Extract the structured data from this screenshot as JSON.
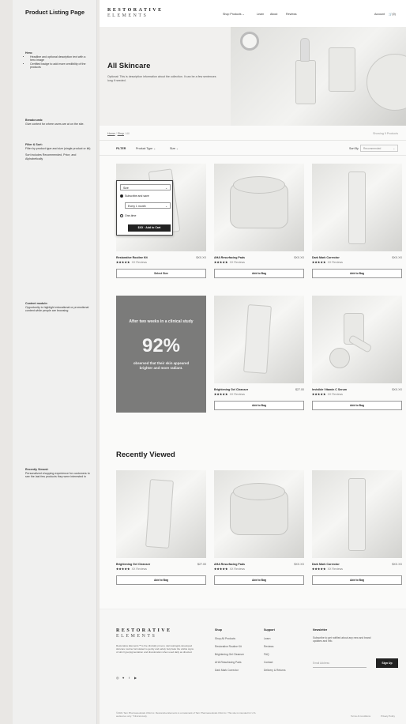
{
  "annotations": {
    "title": "Product Listing Page",
    "hero_head": "Hero:",
    "hero_items": [
      "Headline and optional description text with a hero image",
      "Certified badge to add more credibility of the products"
    ],
    "breadcrumb_head": "Breadcrumb:",
    "breadcrumb_text": "Give context for where users are at on the site.",
    "filter_head": "Filter & Sort:",
    "filter_text": "Filter by product type and size (single product or kit)",
    "sort_text": "Sort includes Recommended, Price, and Alphabetically",
    "content_head": "Content module:",
    "content_text": "Opportunity to highlight educational or promotional content while people are browsing",
    "recent_head": "Recently Viewed:",
    "recent_text": "Personalized shopping experience for customers to see the last few products they were interested in"
  },
  "header": {
    "logo_line1": "RESTORATIVE",
    "logo_line2": "ELEMENTS",
    "nav": [
      "Shop Products",
      "Learn",
      "About",
      "Reviews"
    ],
    "account": "Account",
    "cart": "(0)"
  },
  "hero": {
    "title": "All Skincare",
    "description": "Optional: This is description information about the collection. It can be a few sentences long if needed."
  },
  "breadcrumb": {
    "home": "Home",
    "shop": "Shop",
    "current": "All"
  },
  "showing": "Showing 9 Products",
  "filters": {
    "label": "FILTER",
    "product_type": "Product Type",
    "size": "Size",
    "sort_label": "Sort By",
    "sort_value": "Recommended"
  },
  "popover": {
    "size_select": "Size",
    "subscribe": "Subscribe and save",
    "frequency": "Every 1 month",
    "one_time": "One-time",
    "add_button": "$XX · Add to Cart"
  },
  "products_row1": [
    {
      "name": "Restorative Routine Kit",
      "price": "$XX.XX",
      "stars": "★★★★★",
      "reviews": "XX Reviews",
      "button": "Select Size"
    },
    {
      "name": "AHA Resurfacing Pads",
      "price": "$XX.XX",
      "stars": "★★★★★",
      "reviews": "XX Reviews",
      "button": "Add to Bag"
    },
    {
      "name": "Dark Mark Corrector",
      "price": "$XX.XX",
      "stars": "★★★★★",
      "reviews": "XX Reviews",
      "button": "Add to Bag"
    }
  ],
  "promo": {
    "intro": "After two weeks in a clinical study",
    "stat": "92%",
    "outro": "observed that their skin appeared brighter and more radiant."
  },
  "products_row2": [
    {
      "name": "Brightening Gel Cleanser",
      "price": "$27.00",
      "stars": "★★★★★",
      "reviews": "XX Reviews",
      "button": "Add to Bag"
    },
    {
      "name": "Invisible Vitamin C Serum",
      "price": "$XX.XX",
      "stars": "★★★★★",
      "reviews": "XX Reviews",
      "button": "Add to Bag"
    }
  ],
  "recently_viewed": {
    "title": "Recently Viewed",
    "items": [
      {
        "name": "Brightening Gel Cleanser",
        "price": "$27.00",
        "stars": "★★★★★",
        "reviews": "XX Reviews",
        "button": "Add to Bag"
      },
      {
        "name": "AHA Resurfacing Pads",
        "price": "$XX.XX",
        "stars": "★★★★★",
        "reviews": "XX Reviews",
        "button": "Add to Bag"
      },
      {
        "name": "Dark Mark Corrector",
        "price": "$XX.XX",
        "stars": "★★★★★",
        "reviews": "XX Reviews",
        "button": "Add to Bag"
      }
    ]
  },
  "footer": {
    "logo_line1": "RESTORATIVE",
    "logo_line2": "ELEMENTS",
    "description": "Restorative Elements™ is the clinically proven, dermatologist-developed skincare routine formulated to gently and safely help fade the visible signs of skin hyperpigmentation and discoloration when used daily as directed.",
    "shop_head": "Shop",
    "shop_items": [
      "Shop All Products",
      "Restorative Routine Kit",
      "Brightening Gel Cleanser",
      "AHA Resurfacing Pads",
      "Dark Mark Corrector"
    ],
    "support_head": "Support",
    "support_items": [
      "Learn",
      "Reviews",
      "FAQ",
      "Contact",
      "Delivery & Returns"
    ],
    "newsletter_head": "Newsletter",
    "newsletter_text": "Subscribe to get notified about any new and brand updates and info.",
    "email_placeholder": "Email Address",
    "signup": "Sign Up",
    "copyright": "©2021 Tarn Pharmaceuticals USA Inc. Restorative Elements is a trademark of Tarn Pharmaceuticals USA Inc. This site is intended for U.S. audiences only. *Clinical study.",
    "terms": "Terms & Conditions",
    "privacy": "Privacy Policy"
  }
}
